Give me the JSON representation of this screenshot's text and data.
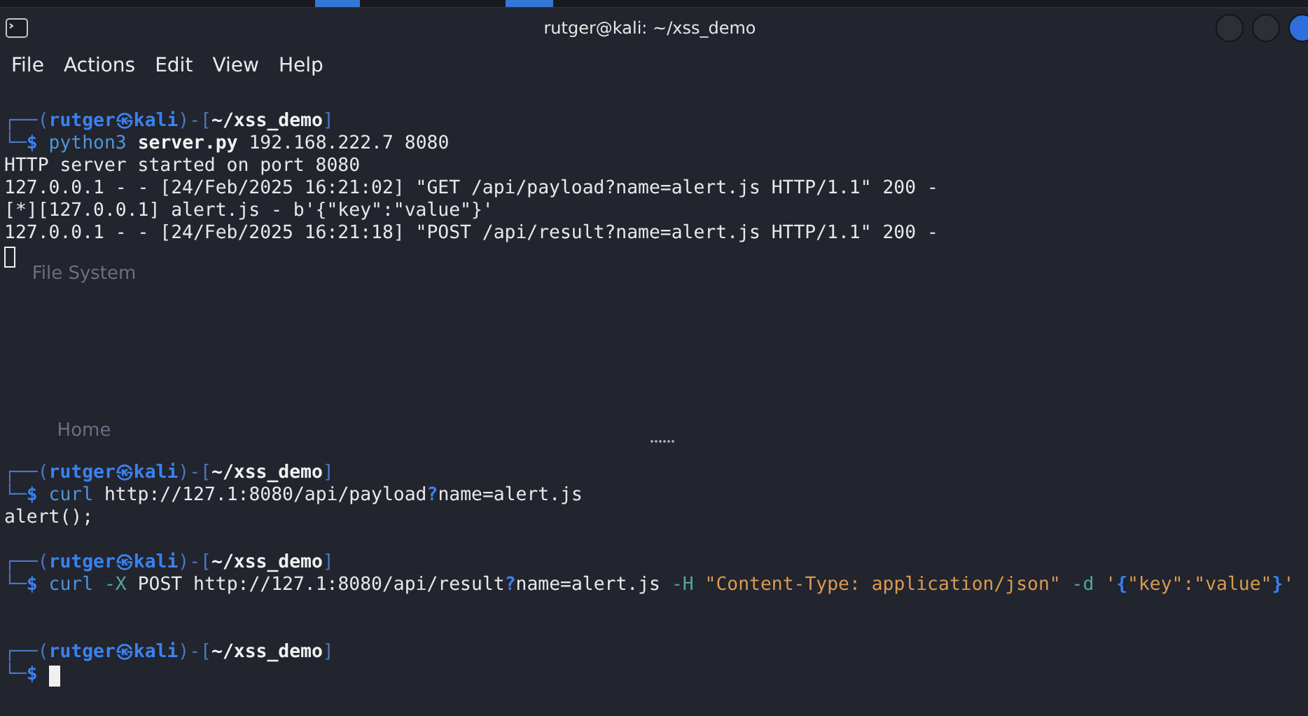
{
  "window": {
    "title": "rutger@kali: ~/xss_demo"
  },
  "menu": [
    "File",
    "Actions",
    "Edit",
    "View",
    "Help"
  ],
  "desktop_icons": [
    {
      "label": "File System"
    },
    {
      "label": "Home"
    }
  ],
  "panes": [
    {
      "focused": false,
      "lines": [
        {
          "kind": "text",
          "segments": [
            {
              "kind": "frame",
              "text": "┌──("
            },
            {
              "kind": "user",
              "text": "rutger㉿kali"
            },
            {
              "kind": "frame",
              "text": ")-["
            },
            {
              "kind": "path",
              "text": "~/xss_demo"
            },
            {
              "kind": "frame",
              "text": "]"
            }
          ]
        },
        {
          "kind": "text",
          "segments": [
            {
              "kind": "frame",
              "text": "└─"
            },
            {
              "kind": "dollar",
              "text": "$"
            },
            {
              "kind": "command",
              "text": " python3"
            },
            {
              "kind": "path",
              "text": " server.py"
            },
            {
              "kind": "plain",
              "text": " 192.168.222.7 8080"
            }
          ]
        },
        {
          "kind": "text",
          "segments": [
            {
              "kind": "plain",
              "text": "HTTP server started on port 8080"
            }
          ]
        },
        {
          "kind": "text",
          "segments": [
            {
              "kind": "plain",
              "text": "127.0.0.1 - - [24/Feb/2025 16:21:02] \"GET /api/payload?name=alert.js HTTP/1.1\" 200 -"
            }
          ]
        },
        {
          "kind": "text",
          "segments": [
            {
              "kind": "plain",
              "text": "[*][127.0.0.1] alert.js - b'{\"key\":\"value\"}'"
            }
          ]
        },
        {
          "kind": "text",
          "segments": [
            {
              "kind": "plain",
              "text": "127.0.0.1 - - [24/Feb/2025 16:21:18] \"POST /api/result?name=alert.js HTTP/1.1\" 200 -"
            }
          ]
        },
        {
          "kind": "cursor"
        }
      ]
    },
    {
      "focused": true,
      "lines": [
        {
          "kind": "text",
          "segments": [
            {
              "kind": "frame",
              "text": "┌──("
            },
            {
              "kind": "user",
              "text": "rutger㉿kali"
            },
            {
              "kind": "frame",
              "text": ")-["
            },
            {
              "kind": "path",
              "text": "~/xss_demo"
            },
            {
              "kind": "frame",
              "text": "]"
            }
          ]
        },
        {
          "kind": "text",
          "segments": [
            {
              "kind": "frame",
              "text": "└─"
            },
            {
              "kind": "dollar",
              "text": "$"
            },
            {
              "kind": "command",
              "text": " curl"
            },
            {
              "kind": "plain",
              "text": " http://127.1:8080/api/payload"
            },
            {
              "kind": "glob",
              "text": "?"
            },
            {
              "kind": "plain",
              "text": "name=alert.js"
            }
          ]
        },
        {
          "kind": "text",
          "segments": [
            {
              "kind": "plain",
              "text": "alert();"
            }
          ]
        },
        {
          "kind": "blank"
        },
        {
          "kind": "text",
          "segments": [
            {
              "kind": "frame",
              "text": "┌──("
            },
            {
              "kind": "user",
              "text": "rutger㉿kali"
            },
            {
              "kind": "frame",
              "text": ")-["
            },
            {
              "kind": "path",
              "text": "~/xss_demo"
            },
            {
              "kind": "frame",
              "text": "]"
            }
          ]
        },
        {
          "kind": "text",
          "segments": [
            {
              "kind": "frame",
              "text": "└─"
            },
            {
              "kind": "dollar",
              "text": "$"
            },
            {
              "kind": "command",
              "text": " curl"
            },
            {
              "kind": "option",
              "text": " -X"
            },
            {
              "kind": "plain",
              "text": " POST http://127.1:8080/api/result"
            },
            {
              "kind": "glob",
              "text": "?"
            },
            {
              "kind": "plain",
              "text": "name=alert.js"
            },
            {
              "kind": "option",
              "text": " -H"
            },
            {
              "kind": "string",
              "text": " \"Content-Type: application/json\""
            },
            {
              "kind": "option",
              "text": " -d"
            },
            {
              "kind": "string",
              "text": " '"
            },
            {
              "kind": "brace",
              "text": "{"
            },
            {
              "kind": "string",
              "text": "\"key\":\"value\""
            },
            {
              "kind": "brace",
              "text": "}"
            },
            {
              "kind": "string",
              "text": "'"
            }
          ]
        },
        {
          "kind": "blank"
        },
        {
          "kind": "blank"
        },
        {
          "kind": "text",
          "segments": [
            {
              "kind": "frame",
              "text": "┌──("
            },
            {
              "kind": "user",
              "text": "rutger㉿kali"
            },
            {
              "kind": "frame",
              "text": ")-["
            },
            {
              "kind": "path",
              "text": "~/xss_demo"
            },
            {
              "kind": "frame",
              "text": "]"
            }
          ]
        },
        {
          "kind": "prompt_cursor",
          "segments": [
            {
              "kind": "frame",
              "text": "└─"
            },
            {
              "kind": "dollar",
              "text": "$"
            }
          ]
        }
      ]
    }
  ]
}
